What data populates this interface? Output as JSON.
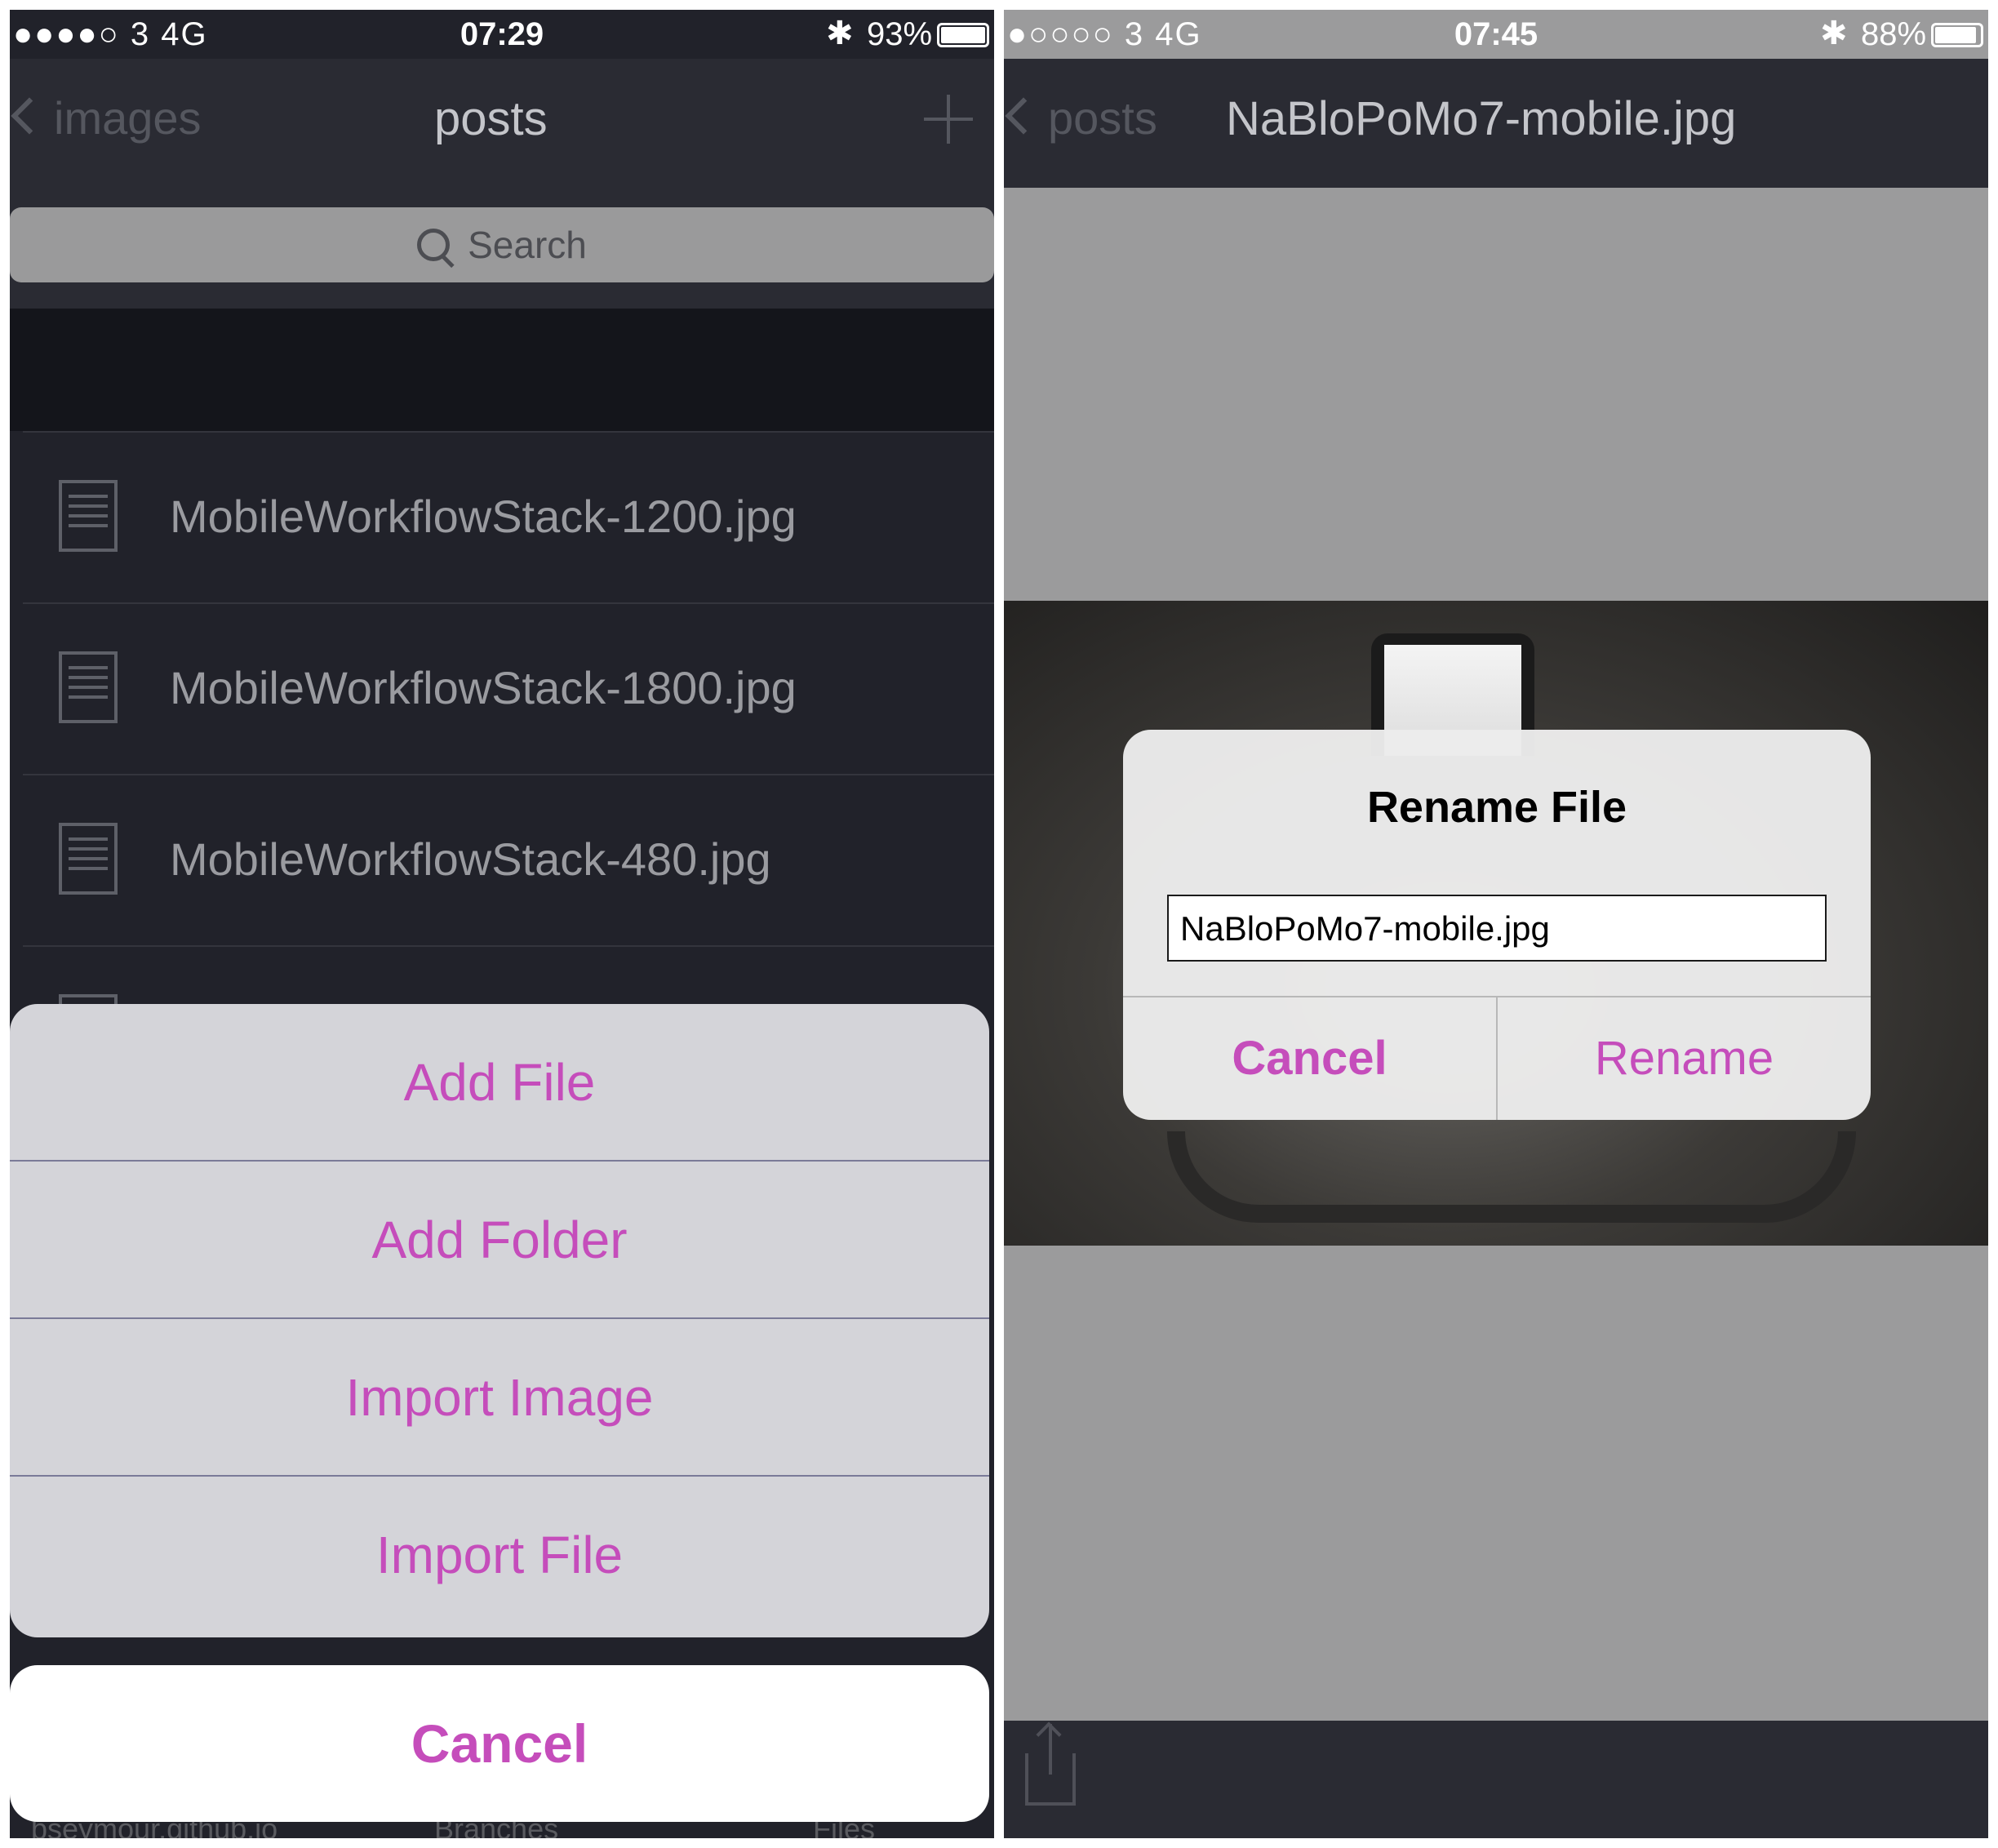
{
  "left": {
    "status": {
      "signal": "●●●●○ 3   4G",
      "time": "07:29",
      "bluetooth": "✱",
      "battery": "93%",
      "battery_level": 0.93
    },
    "nav": {
      "back_label": "images",
      "title": "posts"
    },
    "search": {
      "placeholder": "Search"
    },
    "files": [
      {
        "name": "MobileWorkflowStack-1200.jpg"
      },
      {
        "name": "MobileWorkflowStack-1800.jpg"
      },
      {
        "name": "MobileWorkflowStack-480.jpg"
      }
    ],
    "tabbar": {
      "repo": "bseymour.github.io",
      "branches": "Branches",
      "files": "Files"
    },
    "action_sheet": {
      "items": [
        "Add File",
        "Add Folder",
        "Import Image",
        "Import File"
      ],
      "cancel": "Cancel"
    }
  },
  "right": {
    "status": {
      "signal": "●○○○○ 3   4G",
      "time": "07:45",
      "bluetooth": "✱",
      "battery": "88%",
      "battery_level": 0.88
    },
    "nav": {
      "back_label": "posts",
      "title": "NaBloPoMo7-mobile.jpg"
    },
    "alert": {
      "title": "Rename File",
      "input_value": "NaBloPoMo7-mobile.jpg",
      "cancel": "Cancel",
      "confirm": "Rename"
    }
  },
  "colors": {
    "accent": "#c54dbb",
    "dark_bg": "#21222a",
    "sheet_bg": "#d4d4d9"
  }
}
